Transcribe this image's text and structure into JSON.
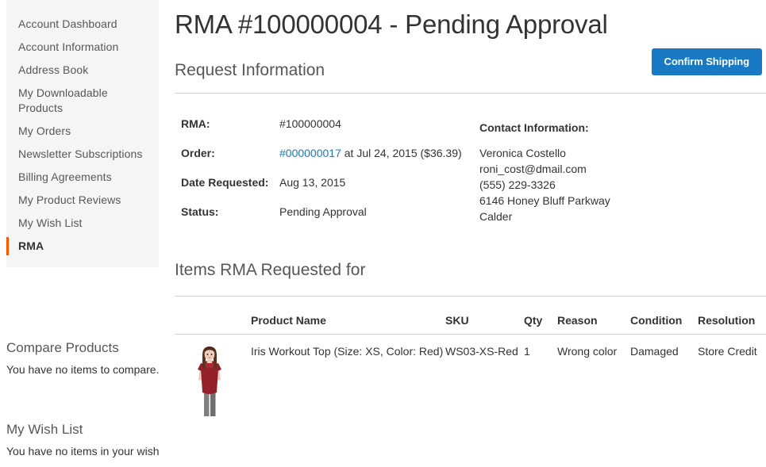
{
  "sidebar": {
    "nav_items": [
      {
        "label": "Account Dashboard",
        "current": false
      },
      {
        "label": "Account Information",
        "current": false
      },
      {
        "label": "Address Book",
        "current": false
      },
      {
        "label": "My Downloadable Products",
        "current": false
      },
      {
        "label": "My Orders",
        "current": false
      },
      {
        "label": "Newsletter Subscriptions",
        "current": false
      },
      {
        "label": "Billing Agreements",
        "current": false
      },
      {
        "label": "My Product Reviews",
        "current": false
      },
      {
        "label": "My Wish List",
        "current": false
      },
      {
        "label": "RMA",
        "current": true
      }
    ],
    "compare_block": {
      "title": "Compare Products",
      "empty_text": "You have no items to compare."
    },
    "wishlist_block": {
      "title": "My Wish List",
      "empty_text": "You have no items in your wish"
    }
  },
  "main": {
    "page_title": "RMA #100000004 - Pending Approval",
    "request_section": {
      "title": "Request Information",
      "confirm_button_label": "Confirm Shipping",
      "details": [
        {
          "label": "RMA:",
          "value": "#100000004",
          "link": null,
          "suffix": null
        },
        {
          "label": "Order:",
          "value": null,
          "link": "#000000017",
          "suffix": " at Jul 24, 2015 ($36.39)"
        },
        {
          "label": "Date Requested:",
          "value": "Aug 13, 2015",
          "link": null,
          "suffix": null
        },
        {
          "label": "Status:",
          "value": "Pending Approval",
          "link": null,
          "suffix": null
        }
      ],
      "contact": {
        "heading": "Contact Information:",
        "lines": [
          "Veronica Costello",
          "roni_cost@dmail.com",
          "(555) 229-3326",
          "6146 Honey Bluff Parkway",
          "Calder"
        ]
      }
    },
    "items_section": {
      "title": "Items RMA Requested for",
      "columns": [
        "",
        "Product Name",
        "SKU",
        "Qty",
        "Reason",
        "Condition",
        "Resolution"
      ],
      "rows": [
        {
          "thumbnail_alt": "product-thumbnail-iris-workout-top",
          "product_name": "Iris Workout Top (Size: XS, Color: Red)",
          "sku": "WS03-XS-Red",
          "qty": "1",
          "reason": "Wrong color",
          "condition": "Damaged",
          "resolution": "Store Credit"
        }
      ]
    }
  },
  "colors": {
    "accent_blue": "#1979c3",
    "active_orange": "#ff5501",
    "sidebar_bg": "#f5f5f5",
    "rule": "#d1d1d1",
    "text": "#333333",
    "muted_text": "#575757"
  }
}
